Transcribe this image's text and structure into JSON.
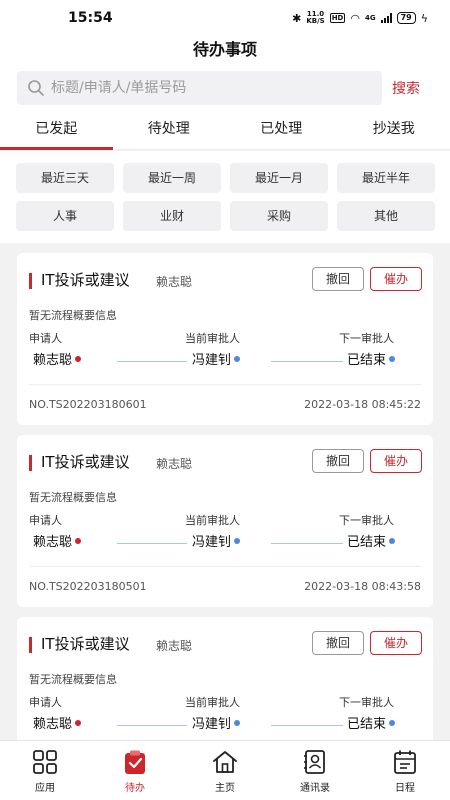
{
  "status_bar": {
    "time": "15:54",
    "net_speed_value": "11.0",
    "net_speed_unit": "KB/S",
    "hd_label": "HD",
    "network": "4G",
    "battery": "79"
  },
  "header": {
    "title": "待办事项"
  },
  "search": {
    "placeholder": "标题/申请人/单据号码",
    "value": "",
    "button_label": "搜索"
  },
  "tabs": [
    {
      "label": "已发起",
      "active": true
    },
    {
      "label": "待处理",
      "active": false
    },
    {
      "label": "已处理",
      "active": false
    },
    {
      "label": "抄送我",
      "active": false
    }
  ],
  "filters": [
    "最近三天",
    "最近一周",
    "最近一月",
    "最近半年",
    "人事",
    "业财",
    "采购",
    "其他"
  ],
  "flow_labels": {
    "applicant": "申请人",
    "current": "当前审批人",
    "next": "下一审批人"
  },
  "cards": [
    {
      "title": "IT投诉或建议",
      "applicant_name": "赖志聪",
      "withdraw_label": "撤回",
      "urge_label": "催办",
      "summary": "暂无流程概要信息",
      "applicant": "赖志聪",
      "current_approver": "冯建钊",
      "next_approver": "已结束",
      "number": "NO.TS202203180601",
      "time": "2022-03-18 08:45:22"
    },
    {
      "title": "IT投诉或建议",
      "applicant_name": "赖志聪",
      "withdraw_label": "撤回",
      "urge_label": "催办",
      "summary": "暂无流程概要信息",
      "applicant": "赖志聪",
      "current_approver": "冯建钊",
      "next_approver": "已结束",
      "number": "NO.TS202203180501",
      "time": "2022-03-18 08:43:58"
    },
    {
      "title": "IT投诉或建议",
      "applicant_name": "赖志聪",
      "withdraw_label": "撤回",
      "urge_label": "催办",
      "summary": "暂无流程概要信息",
      "applicant": "赖志聪",
      "current_approver": "冯建钊",
      "next_approver": "已结束",
      "number": "",
      "time": ""
    }
  ],
  "bottom_nav": [
    {
      "label": "应用",
      "icon": "grid-icon",
      "active": false
    },
    {
      "label": "待办",
      "icon": "clipboard-check-icon",
      "active": true
    },
    {
      "label": "主页",
      "icon": "home-icon",
      "active": false
    },
    {
      "label": "通讯录",
      "icon": "contacts-icon",
      "active": false
    },
    {
      "label": "日程",
      "icon": "calendar-icon",
      "active": false
    }
  ],
  "colors": {
    "accent": "#c8282e",
    "line_blue": "#aac6ea",
    "dot_blue": "#4a8ad8",
    "dot_red": "#d0242b"
  }
}
